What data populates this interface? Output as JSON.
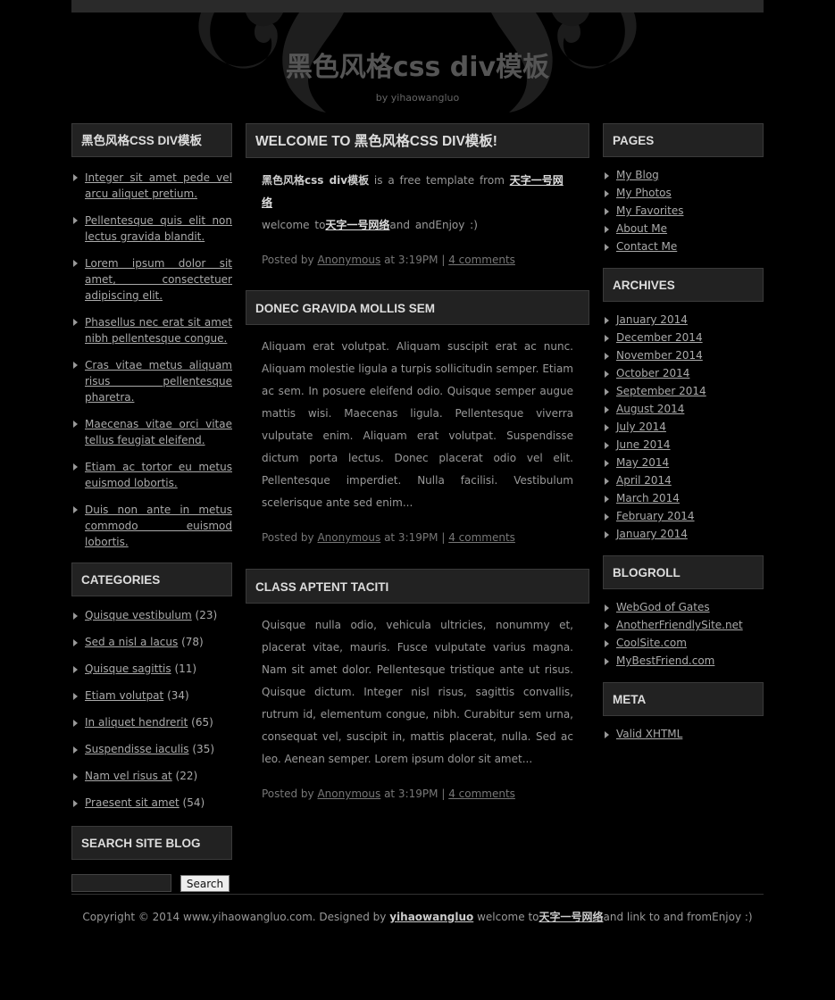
{
  "header": {
    "title": "黑色风格css div模板",
    "subtitle": "by yihaowangluo"
  },
  "left": {
    "box1_title": "黑色风格CSS DIV模板",
    "links": [
      "Integer sit amet pede vel arcu aliquet pretium.",
      "Pellentesque quis elit non lectus gravida blandit.",
      "Lorem ipsum dolor sit amet, consectetuer adipiscing elit.",
      "Phasellus nec erat sit amet nibh pellentesque congue.",
      "Cras vitae metus aliquam risus pellentesque pharetra.",
      "Maecenas vitae orci vitae tellus feugiat eleifend.",
      "Etiam ac tortor eu metus euismod lobortis.",
      "Duis non ante in metus commodo euismod lobortis."
    ],
    "categories_title": "CATEGORIES",
    "categories": [
      {
        "name": "Quisque vestibulum",
        "count": "(23)"
      },
      {
        "name": "Sed a nisl a lacus",
        "count": "(78)"
      },
      {
        "name": "Quisque sagittis",
        "count": "(11)"
      },
      {
        "name": "Etiam volutpat",
        "count": "(34)"
      },
      {
        "name": "In aliquet hendrerit",
        "count": "(65)"
      },
      {
        "name": "Suspendisse iaculis",
        "count": "(35)"
      },
      {
        "name": "Nam vel risus at",
        "count": "(22)"
      },
      {
        "name": "Praesent sit amet",
        "count": "(54)"
      }
    ],
    "search_title": "SEARCH SITE BLOG",
    "search_button": "Search"
  },
  "posts": [
    {
      "title": "WELCOME TO 黑色风格CSS DIV模板!",
      "body_bold": "黑色风格css div模板",
      "body_mid": " is a free template from ",
      "body_link": "天字一号网络",
      "body_line2_pre": "welcome to",
      "body_line2_link": "天字一号网络",
      "body_line2_post": "and andEnjoy :)",
      "posted_by": "Posted by",
      "author": "Anonymous",
      "time": "at 3:19PM",
      "sep": "|",
      "comments": "4 comments"
    },
    {
      "title": "DONEC GRAVIDA MOLLIS SEM",
      "body": "Aliquam erat volutpat. Aliquam suscipit erat ac nunc. Aliquam molestie ligula a turpis sollicitudin semper. Etiam ac sem. In posuere eleifend odio. Quisque semper augue mattis wisi. Maecenas ligula. Pellentesque viverra vulputate enim. Aliquam erat volutpat. Suspendisse dictum porta lectus. Donec placerat odio vel elit. Pellentesque imperdiet. Nulla facilisi. Vestibulum scelerisque ante sed enim...",
      "posted_by": "Posted by",
      "author": "Anonymous",
      "time": "at 3:19PM",
      "sep": "|",
      "comments": "4 comments"
    },
    {
      "title": "CLASS APTENT TACITI",
      "body": "Quisque nulla odio, vehicula ultricies, nonummy et, placerat vitae, mauris. Fusce vulputate varius magna. Nam sit amet dolor. Pellentesque tristique ante ut risus. Quisque dictum. Integer nisl risus, sagittis convallis, rutrum id, elementum congue, nibh. Curabitur sem urna, consequat vel, suscipit in, mattis placerat, nulla. Sed ac leo. Aenean semper. Lorem ipsum dolor sit amet...",
      "posted_by": "Posted by",
      "author": "Anonymous",
      "time": "at 3:19PM",
      "sep": "|",
      "comments": "4 comments"
    }
  ],
  "right": {
    "pages_title": "PAGES",
    "pages": [
      "My Blog",
      "My Photos",
      "My Favorites",
      "About Me",
      "Contact Me"
    ],
    "archives_title": "ARCHIVES",
    "archives": [
      "January 2014",
      "December 2014",
      "November 2014",
      "October 2014",
      "September 2014",
      "August 2014",
      "July 2014",
      "June 2014",
      "May 2014",
      "April 2014",
      "March 2014",
      "February 2014",
      "January 2014"
    ],
    "blogroll_title": "BLOGROLL",
    "blogroll": [
      "WebGod of Gates",
      "AnotherFriendlySite.net",
      "CoolSite.com",
      "MyBestFriend.com"
    ],
    "meta_title": "META",
    "meta": [
      "Valid XHTML"
    ]
  },
  "footer": {
    "pre": "Copyright © 2014 www.yihaowangluo.com. Designed by ",
    "designer": "yihaowangluo",
    "mid": " welcome to",
    "link": "天字一号网络",
    "post": "and link to and fromEnjoy :)"
  }
}
